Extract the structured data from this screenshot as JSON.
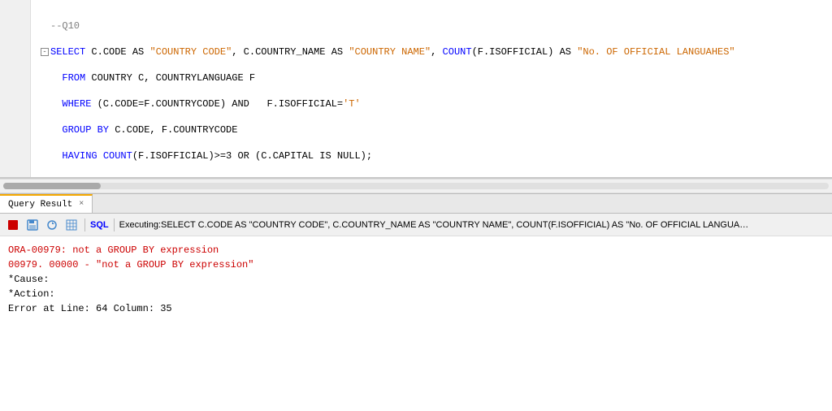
{
  "editor": {
    "lines": [
      {
        "num": "",
        "content": "--Q10",
        "type": "comment"
      },
      {
        "num": "",
        "content": "SELECT C.CODE AS \"COUNTRY CODE\", C.COUNTRY_NAME AS \"COUNTRY NAME\", COUNT(F.ISOFFICIAL) AS \"No. OF OFFICIAL LANGUAHES\"",
        "type": "select",
        "hasCollapse": true
      },
      {
        "num": "",
        "content": "  FROM COUNTRY C, COUNTRYLANGUAGE F",
        "type": "from"
      },
      {
        "num": "",
        "content": "  WHERE (C.CODE=F.COUNTRYCODE) AND   F.ISOFFICIAL='T'",
        "type": "where"
      },
      {
        "num": "",
        "content": "  GROUP BY C.CODE, F.COUNTRYCODE",
        "type": "group"
      },
      {
        "num": "",
        "content": "  HAVING COUNT(F.ISOFFICIAL)>=3 OR (C.CAPITAL IS NULL);",
        "type": "having"
      }
    ]
  },
  "result_panel": {
    "tab_label": "Query Result",
    "tab_close": "×",
    "sql_label": "SQL",
    "executing_text": "Executing:SELECT C.CODE AS \"COUNTRY CODE\", C.COUNTRY_NAME AS \"COUNTRY NAME\", COUNT(F.ISOFFICIAL) AS \"No. OF OFFICIAL LANGUAHES\"FROM COUNTRY C, COUNTRY",
    "error": {
      "line1": "ORA-00979: not a GROUP BY expression",
      "line2": "00979. 00000 -  \"not a GROUP BY expression\"",
      "line3": "*Cause:",
      "line4": "*Action:",
      "line5": "Error at Line: 64 Column: 35"
    }
  }
}
